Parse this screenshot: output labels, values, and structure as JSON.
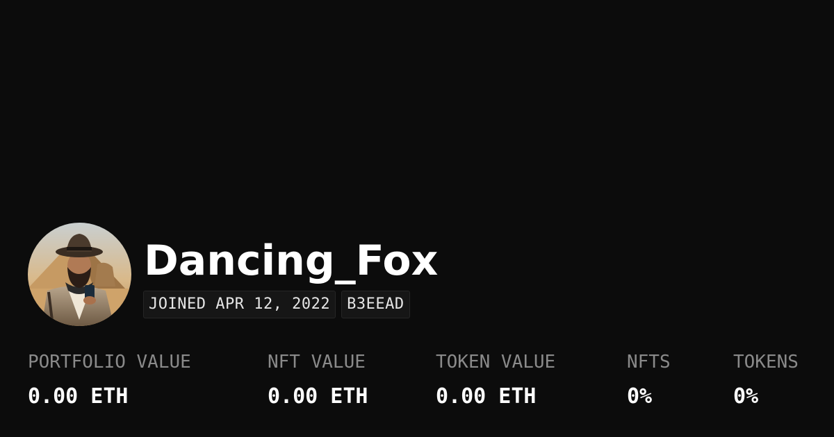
{
  "profile": {
    "username": "Dancing_Fox",
    "joined": "JOINED APR 12, 2022",
    "address_tag": "B3EEAD",
    "avatar_icon": "profile-avatar-image"
  },
  "stats": [
    {
      "label": "PORTFOLIO VALUE",
      "value": "0.00 ETH"
    },
    {
      "label": "NFT VALUE",
      "value": "0.00 ETH"
    },
    {
      "label": "TOKEN VALUE",
      "value": "0.00 ETH"
    },
    {
      "label": "NFTS",
      "value": "0%"
    },
    {
      "label": "TOKENS",
      "value": "0%"
    }
  ],
  "colors": {
    "background": "#0c0c0c",
    "text_primary": "#ffffff",
    "text_muted": "#8a8a8a",
    "badge_bg": "#161616"
  }
}
